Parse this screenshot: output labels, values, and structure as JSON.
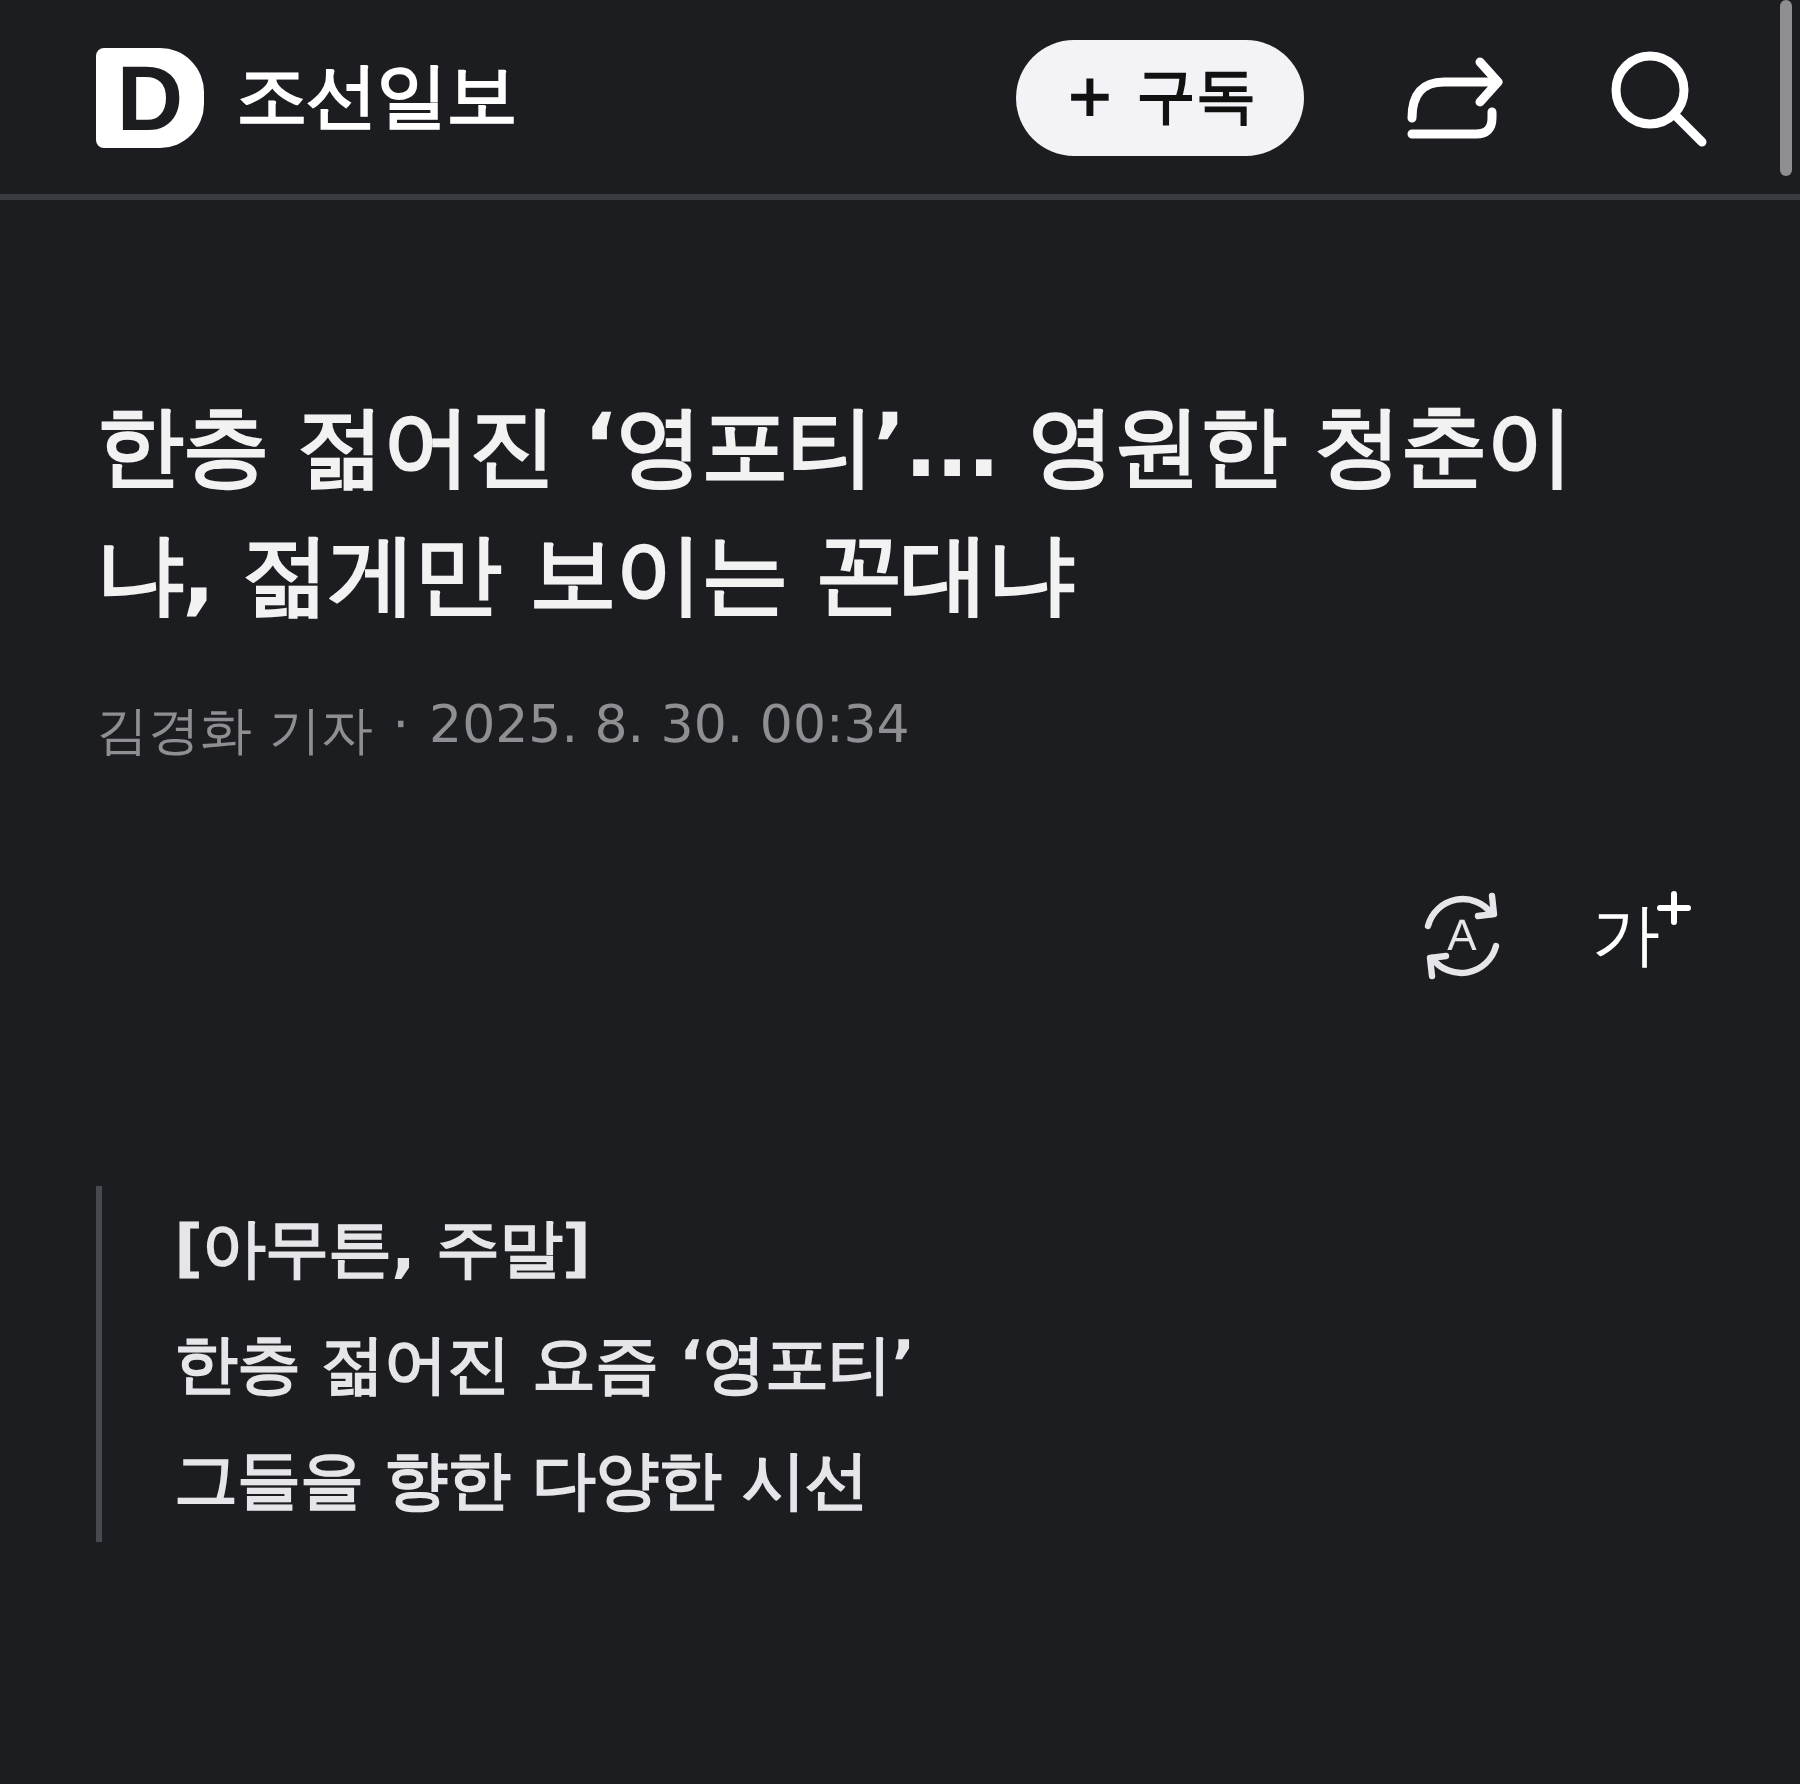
{
  "header": {
    "logo_mark": "D",
    "brand": "조선일보",
    "subscribe_button": "+ 구독"
  },
  "article": {
    "title": "한층 젊어진 ‘영포티’... 영원한 청춘이냐, 젊게만 보이는 꼰대냐",
    "byline": {
      "author": "김경화 기자",
      "separator": "·",
      "date": "2025. 8. 30. 00:34"
    },
    "tools": {
      "translate_label": "A",
      "font_size_label": "가"
    },
    "summary": [
      "[아무튼, 주말]",
      "한층 젊어진 요즘 ‘영포티’",
      "그들을 향한 다양한 시선"
    ]
  }
}
